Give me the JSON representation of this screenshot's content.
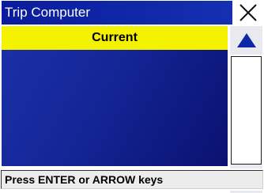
{
  "window": {
    "title": "Trip Computer",
    "close_icon": "close-icon"
  },
  "list": {
    "header_label": "Current",
    "header_color": "#f4f200"
  },
  "scrollbar": {
    "up_icon": "arrow-up-icon",
    "down_icon": "arrow-down-icon",
    "arrow_color": "#0c2aa6"
  },
  "status": {
    "text": "Press ENTER or ARROW keys"
  }
}
